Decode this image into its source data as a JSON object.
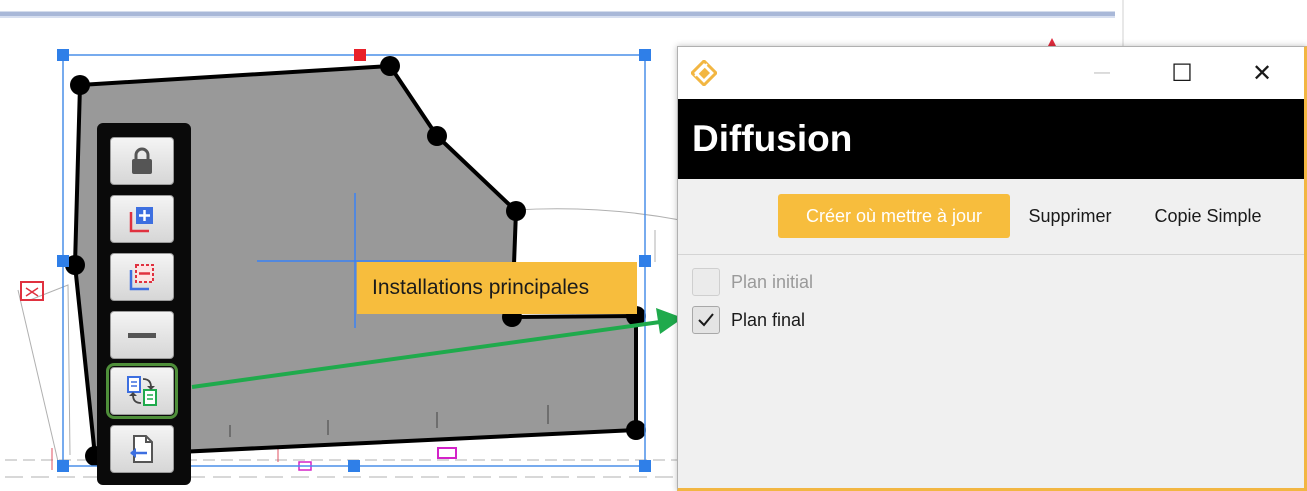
{
  "canvas": {
    "object_label": "Installations principales",
    "icons": [
      "lock-icon",
      "add-copy-icon",
      "remove-copy-icon",
      "minus-icon",
      "diffuse-swap-icon",
      "export-page-icon"
    ]
  },
  "dialog": {
    "title": "Diffusion",
    "controls": {
      "minimize": "—",
      "maximize": "☐",
      "close": "✕"
    },
    "actions": {
      "create_update": "Créer où mettre à jour",
      "delete": "Supprimer",
      "simple_copy": "Copie Simple"
    },
    "plans": [
      {
        "label": "Plan initial",
        "checked": false,
        "enabled": false
      },
      {
        "label": "Plan final",
        "checked": true,
        "enabled": true
      }
    ]
  },
  "colors": {
    "accent": "#f7bd3d",
    "header_bg": "#000000",
    "selection": "#3b82f6",
    "arrow": "#1faa4c",
    "shape_fill": "#999999",
    "handle_red": "#e8202a"
  }
}
